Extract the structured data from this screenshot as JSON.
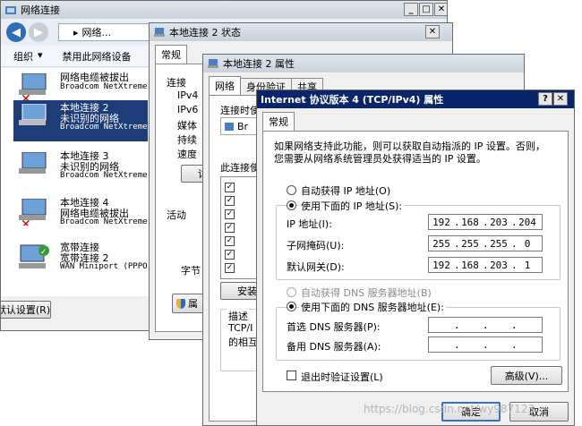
{
  "net_window": {
    "title": "网络连接",
    "breadcrumb": "网络...",
    "breadcrumb_sep": "▸",
    "toolbar": {
      "organize": "组织",
      "organize_arrow": "▾",
      "disable": "禁用此网络设备"
    },
    "adapters": [
      {
        "name": "网络电缆被拔出",
        "device": "Broadcom NetXtreme",
        "status": ""
      },
      {
        "name": "本地连接 2",
        "status": "未识别的网络",
        "device": "Broadcom NetXtreme"
      },
      {
        "name": "本地连接 3",
        "status": "未识别的网络",
        "device": "Broadcom NetXtreme"
      },
      {
        "name": "本地连接 4",
        "status": "网络电缆被拔出",
        "device": "Broadcom NetXtreme"
      },
      {
        "name": "宽带连接",
        "status": "宽带连接 2",
        "device": "WAN Miniport (PPPO"
      }
    ],
    "bottom_button": "默认设置(R)"
  },
  "status_window": {
    "title": "本地连接 2 状态",
    "tab": "常规",
    "section_connection": "连接",
    "rows": [
      "IPv4",
      "IPv6",
      "媒体",
      "持续",
      "速度"
    ],
    "details_button": "详细",
    "section_activity": "活动",
    "bytes_label": "字节",
    "properties_button": "属"
  },
  "props_window": {
    "title": "本地连接 2 属性",
    "tabs": [
      "网络",
      "身份验证",
      "共享"
    ],
    "connect_using": "连接时使",
    "adapter_short": "Br",
    "items_label": "此连接使",
    "install_button": "安装",
    "description_label": "描述",
    "description_text_1": "TCP/I",
    "description_text_2": "的相互"
  },
  "ipv4_dialog": {
    "title": "Internet 协议版本 4 (TCP/IPv4) 属性",
    "help_btn": "?",
    "close_btn": "✕",
    "tab": "常规",
    "description_line1": "如果网络支持此功能，则可以获取自动指派的 IP 设置。否则，",
    "description_line2": "您需要从网络系统管理员处获得适当的 IP 设置。",
    "auto_ip": "自动获得 IP 地址(O)",
    "manual_ip": "使用下面的 IP 地址(S):",
    "ip_label": "IP 地址(I):",
    "ip_value": [
      "192",
      "168",
      "203",
      "204"
    ],
    "mask_label": "子网掩码(U):",
    "mask_value": [
      "255",
      "255",
      "255",
      "0"
    ],
    "gateway_label": "默认网关(D):",
    "gateway_value": [
      "192",
      "168",
      "203",
      "1"
    ],
    "auto_dns": "自动获得 DNS 服务器地址(B)",
    "manual_dns": "使用下面的 DNS 服务器地址(E):",
    "dns1_label": "首选 DNS 服务器(P):",
    "dns2_label": "备用 DNS 服务器(A):",
    "validate": "退出时验证设置(L)",
    "advanced": "高级(V)...",
    "ok": "确定",
    "cancel": "取消"
  },
  "watermark": "https://blog.csdn.net/wy987123",
  "window_controls": {
    "min": "_",
    "max": "□",
    "close": "✕"
  },
  "colors": {
    "active_title": "#0a246a",
    "selection": "#1e3c78",
    "window_bg": "#f0f0f0"
  }
}
